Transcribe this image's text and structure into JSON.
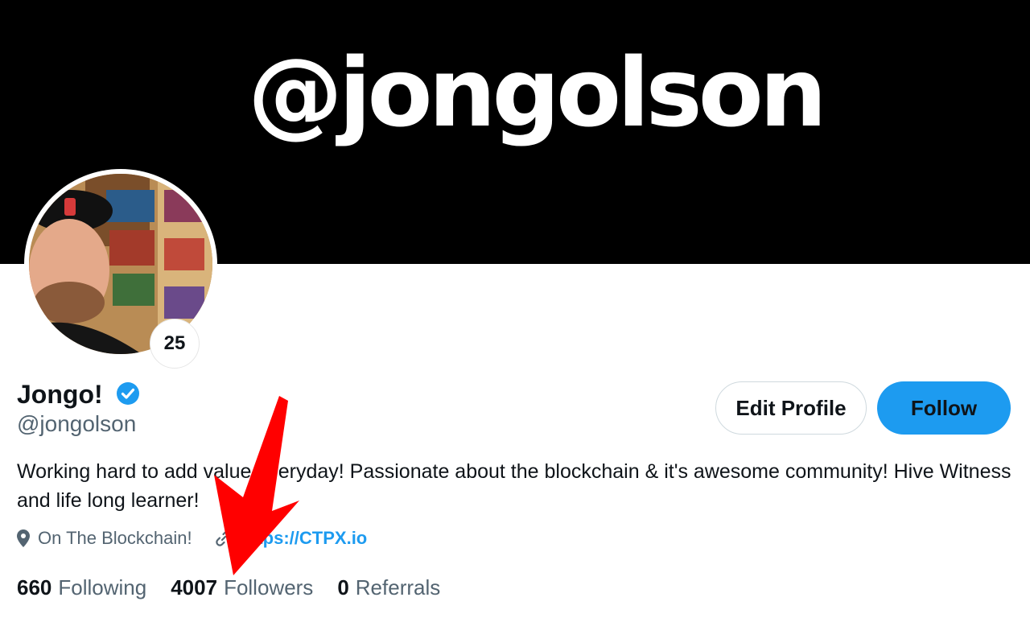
{
  "banner": {
    "text": "@jongolson"
  },
  "avatar": {
    "level": "25"
  },
  "profile": {
    "display_name": "Jongo!",
    "handle": "@jongolson",
    "bio": "Working hard to add value everyday! Passionate about the blockchain & it's awesome community! Hive Witness and life long learner!",
    "location": "On The Blockchain!",
    "website": "https://CTPX.io"
  },
  "actions": {
    "edit_label": "Edit Profile",
    "follow_label": "Follow"
  },
  "stats": {
    "following_count": "660",
    "following_label": "Following",
    "followers_count": "4007",
    "followers_label": "Followers",
    "referrals_count": "0",
    "referrals_label": "Referrals"
  },
  "colors": {
    "accent": "#1d9bf0",
    "banner": "#000000",
    "annotation_arrow": "#ff0000",
    "muted_text": "#536471"
  },
  "icons": [
    "verified-icon",
    "location-pin-icon",
    "link-icon"
  ]
}
